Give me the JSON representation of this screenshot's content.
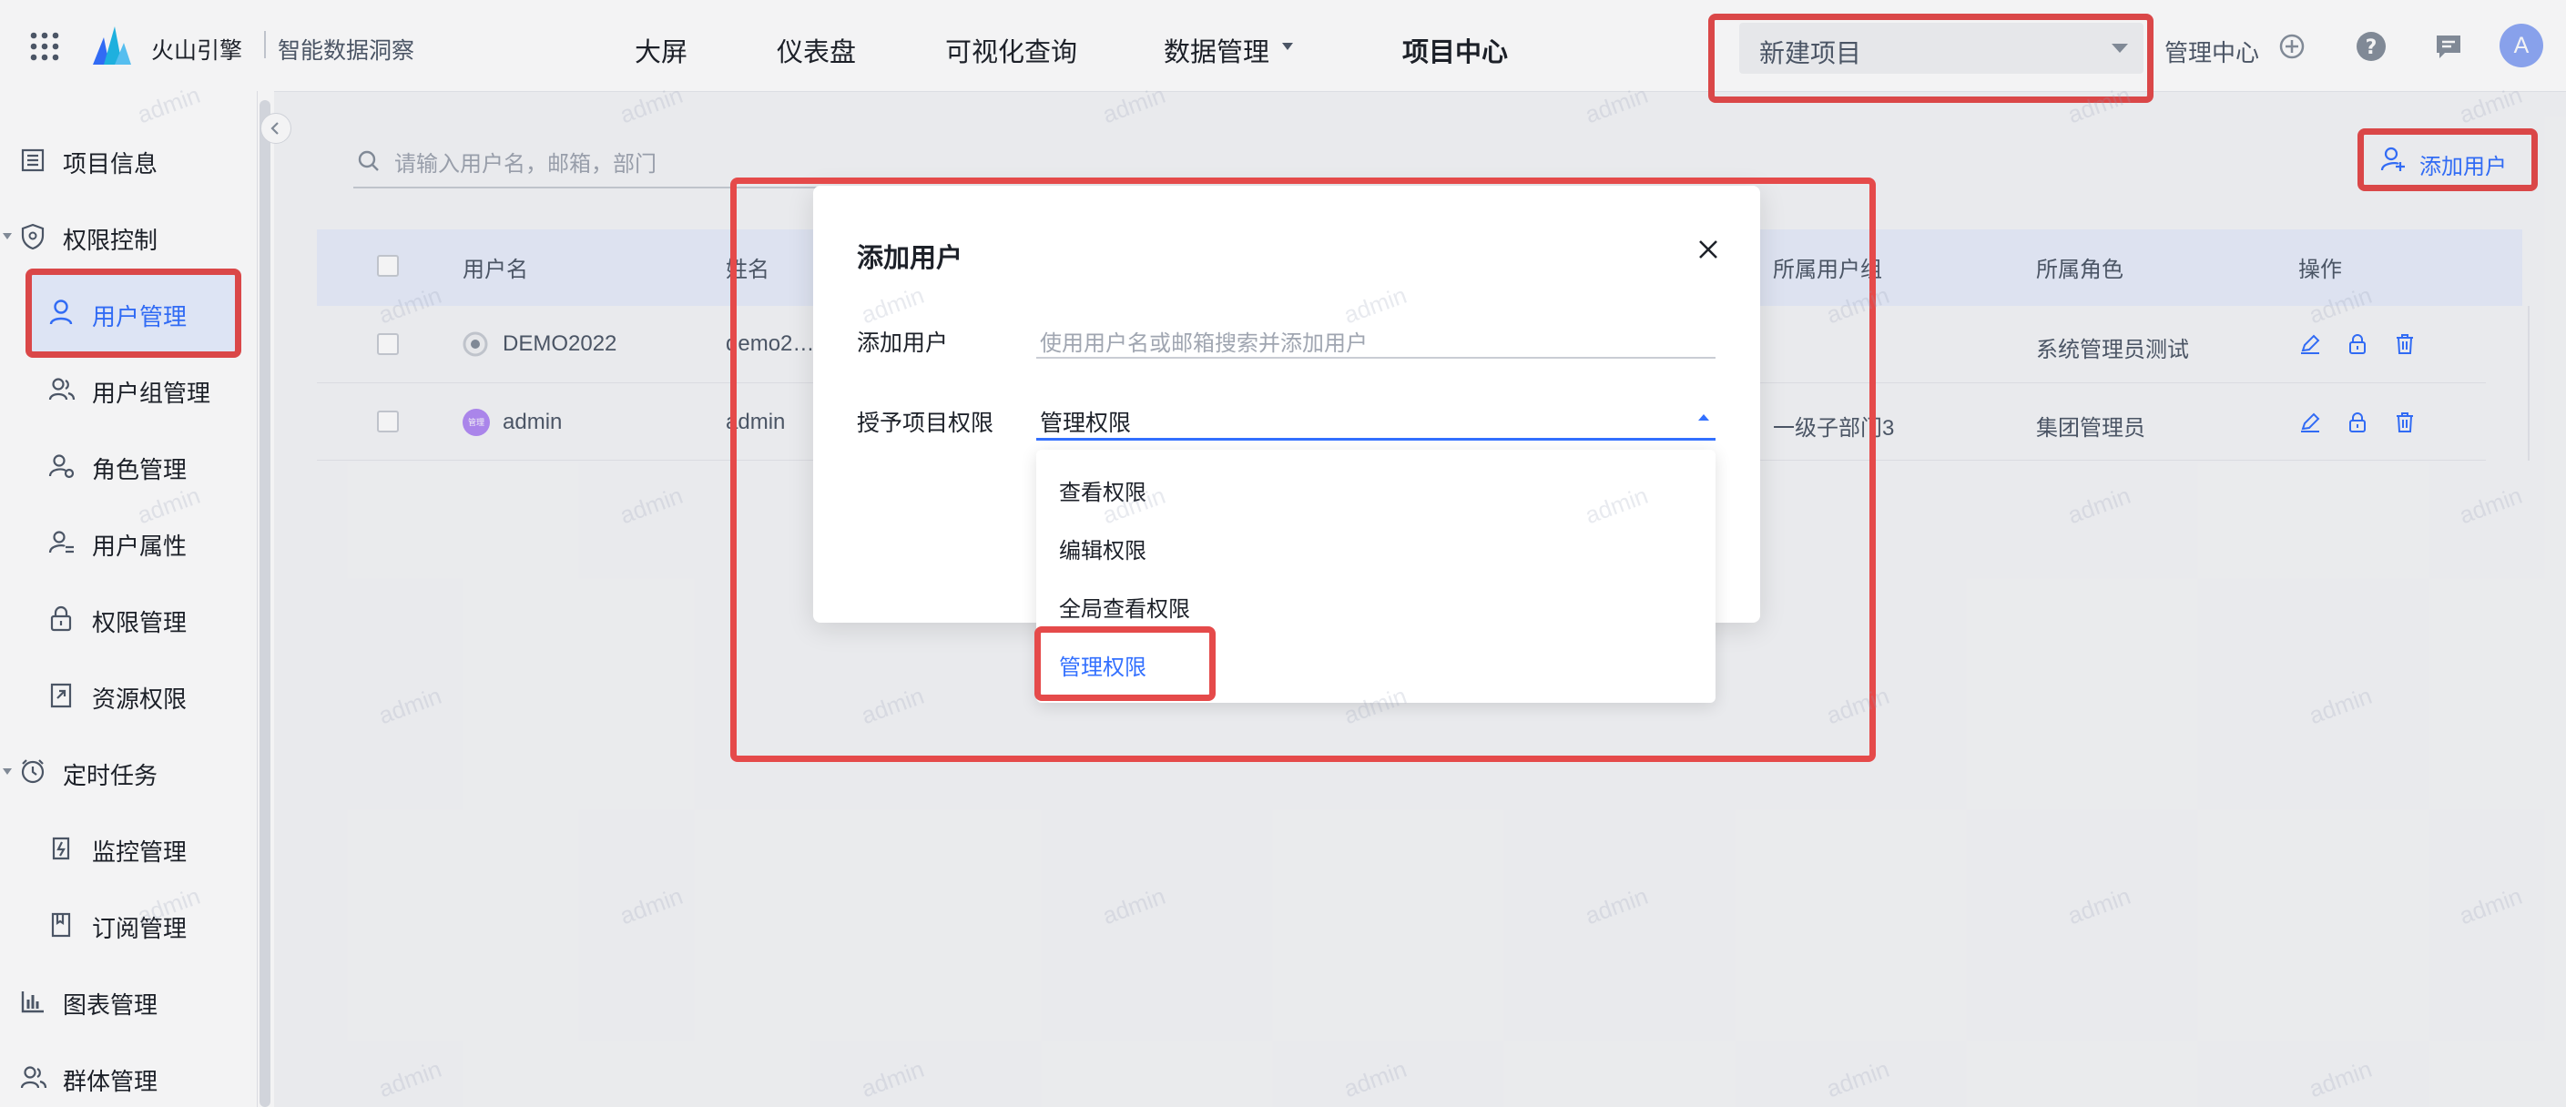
{
  "header": {
    "brand": "火山引擎",
    "product": "智能数据洞察",
    "nav": [
      "大屏",
      "仪表盘",
      "可视化查询",
      "数据管理",
      "项目中心"
    ],
    "project_select": "新建项目",
    "admin_center": "管理中心",
    "avatar": "A"
  },
  "sidebar": {
    "items": [
      {
        "label": "项目信息",
        "icon": "list-icon"
      },
      {
        "label": "权限控制",
        "icon": "shield-icon"
      },
      {
        "label": "用户管理",
        "icon": "user-icon"
      },
      {
        "label": "用户组管理",
        "icon": "user-group-icon"
      },
      {
        "label": "角色管理",
        "icon": "role-icon"
      },
      {
        "label": "用户属性",
        "icon": "user-attribute-icon"
      },
      {
        "label": "权限管理",
        "icon": "lock-icon"
      },
      {
        "label": "资源权限",
        "icon": "resource-icon"
      },
      {
        "label": "定时任务",
        "icon": "clock-icon"
      },
      {
        "label": "监控管理",
        "icon": "monitor-icon"
      },
      {
        "label": "订阅管理",
        "icon": "bookmark-icon"
      },
      {
        "label": "图表管理",
        "icon": "bar-chart-icon"
      },
      {
        "label": "群体管理",
        "icon": "group-icon"
      }
    ]
  },
  "main": {
    "search_placeholder": "请输入用户名，邮箱，部门",
    "add_user_button": "添加用户",
    "columns": [
      "用户名",
      "姓名",
      "所属用户组",
      "所属角色",
      "操作"
    ],
    "rows": [
      {
        "username": "DEMO2022",
        "name": "demo2…",
        "group": "",
        "role": "系统管理员测试"
      },
      {
        "username": "admin",
        "avatar_text": "管理",
        "name": "admin",
        "group": "一级子部门3",
        "role": "集团管理员"
      }
    ]
  },
  "modal": {
    "title": "添加用户",
    "add_user_label": "添加用户",
    "add_user_placeholder": "使用用户名或邮箱搜索并添加用户",
    "grant_label": "授予项目权限",
    "selected": "管理权限",
    "options": [
      "查看权限",
      "编辑权限",
      "全局查看权限",
      "管理权限"
    ]
  },
  "watermark": "admin",
  "colors": {
    "accent": "#3370ff",
    "highlight": "#e54a4a"
  }
}
